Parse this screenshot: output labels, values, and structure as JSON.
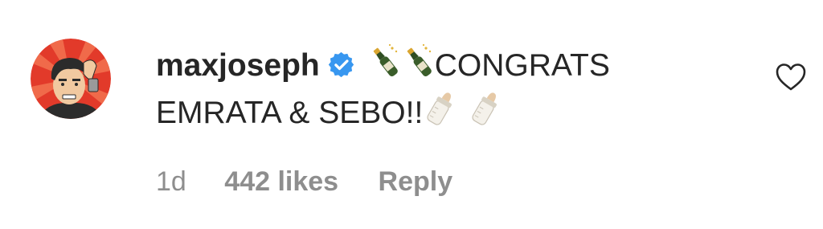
{
  "comment": {
    "username": "maxjoseph",
    "text_line1": "CONGRATS",
    "text_line2": "EMRATA & SEBO!!",
    "time": "1d",
    "likes": "442 likes",
    "reply_label": "Reply"
  },
  "icons": {
    "verified": "verified-badge-icon",
    "like": "heart-outline-icon",
    "emoji_1": "champagne-bottle-emoji",
    "emoji_2": "baby-bottle-emoji"
  },
  "colors": {
    "text": "#262626",
    "secondary": "#8e8e8e",
    "verified_blue": "#3897f0",
    "avatar_bg": "#e23a2a"
  }
}
